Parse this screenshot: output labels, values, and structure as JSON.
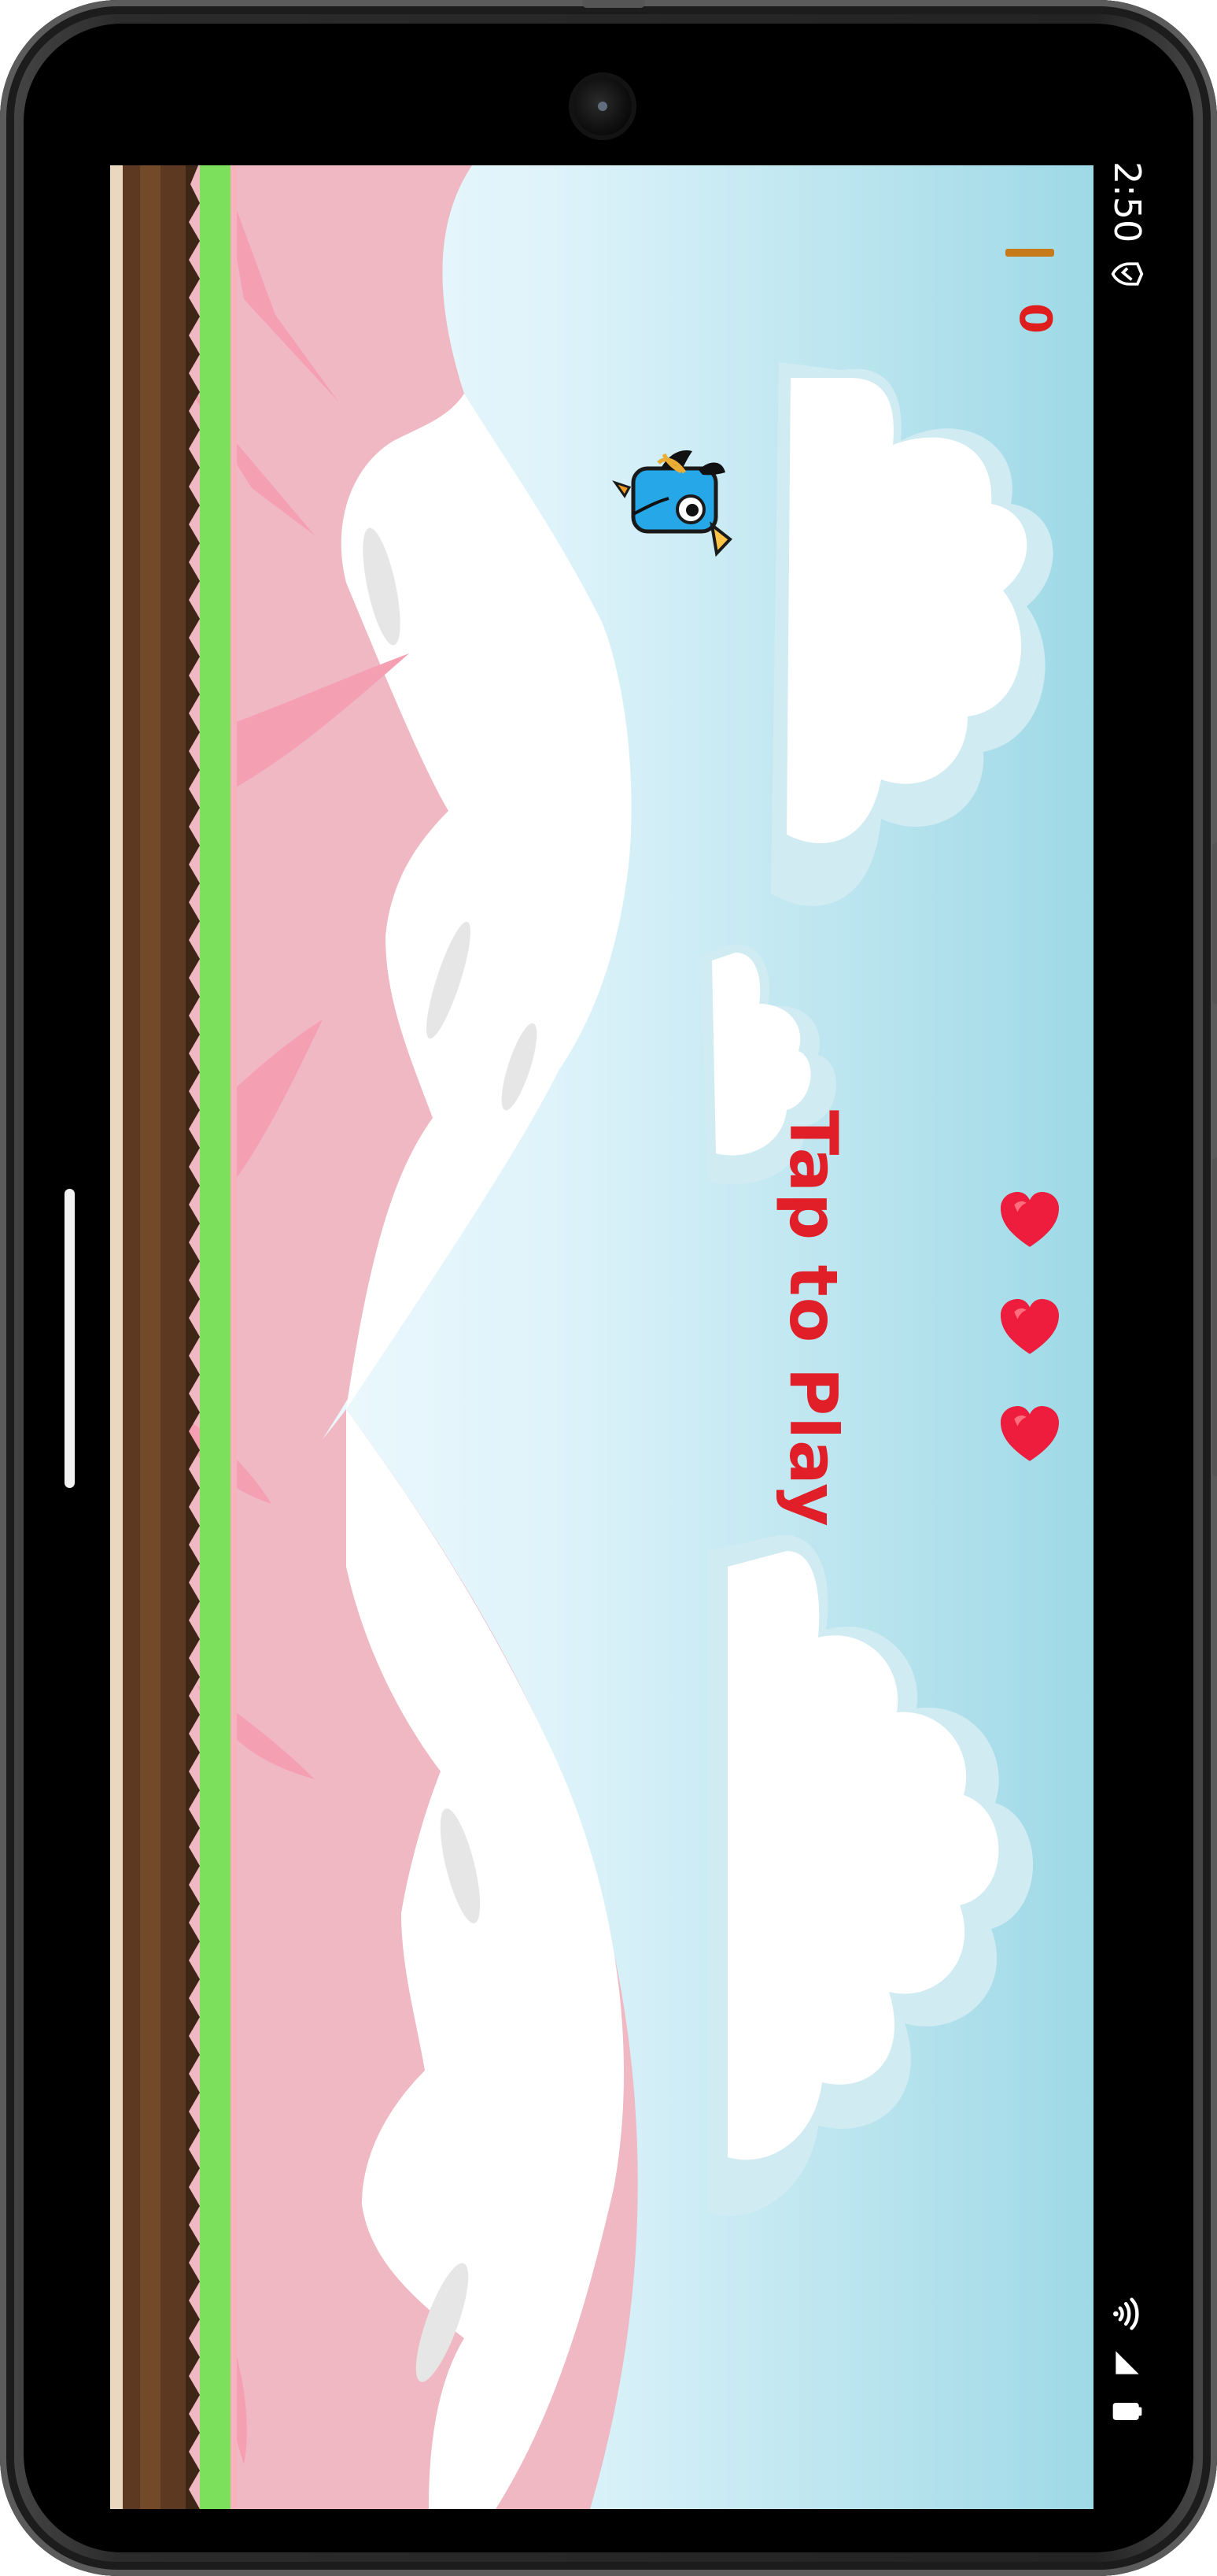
{
  "status_bar": {
    "time": "2:50",
    "left_icons": [
      "shield-icon"
    ],
    "right_icons": [
      "wifi-icon",
      "signal-icon",
      "battery-icon"
    ]
  },
  "game": {
    "score": "0",
    "prompt": "Tap to Play",
    "lives": 3,
    "player": "blue-bird",
    "colors": {
      "sky_light": "#f3fbfe",
      "sky_dark": "#a3dce8",
      "mountain_pink": "#f0b6c0",
      "mountain_dark_pink": "#f59aad",
      "snow": "#ffffff",
      "cloud": "#ffffff",
      "ground_green": "#7ae05c",
      "ground_brown": "#5f3b1f",
      "text_red": "#e11f28",
      "heart_red": "#ef1d3d"
    }
  }
}
